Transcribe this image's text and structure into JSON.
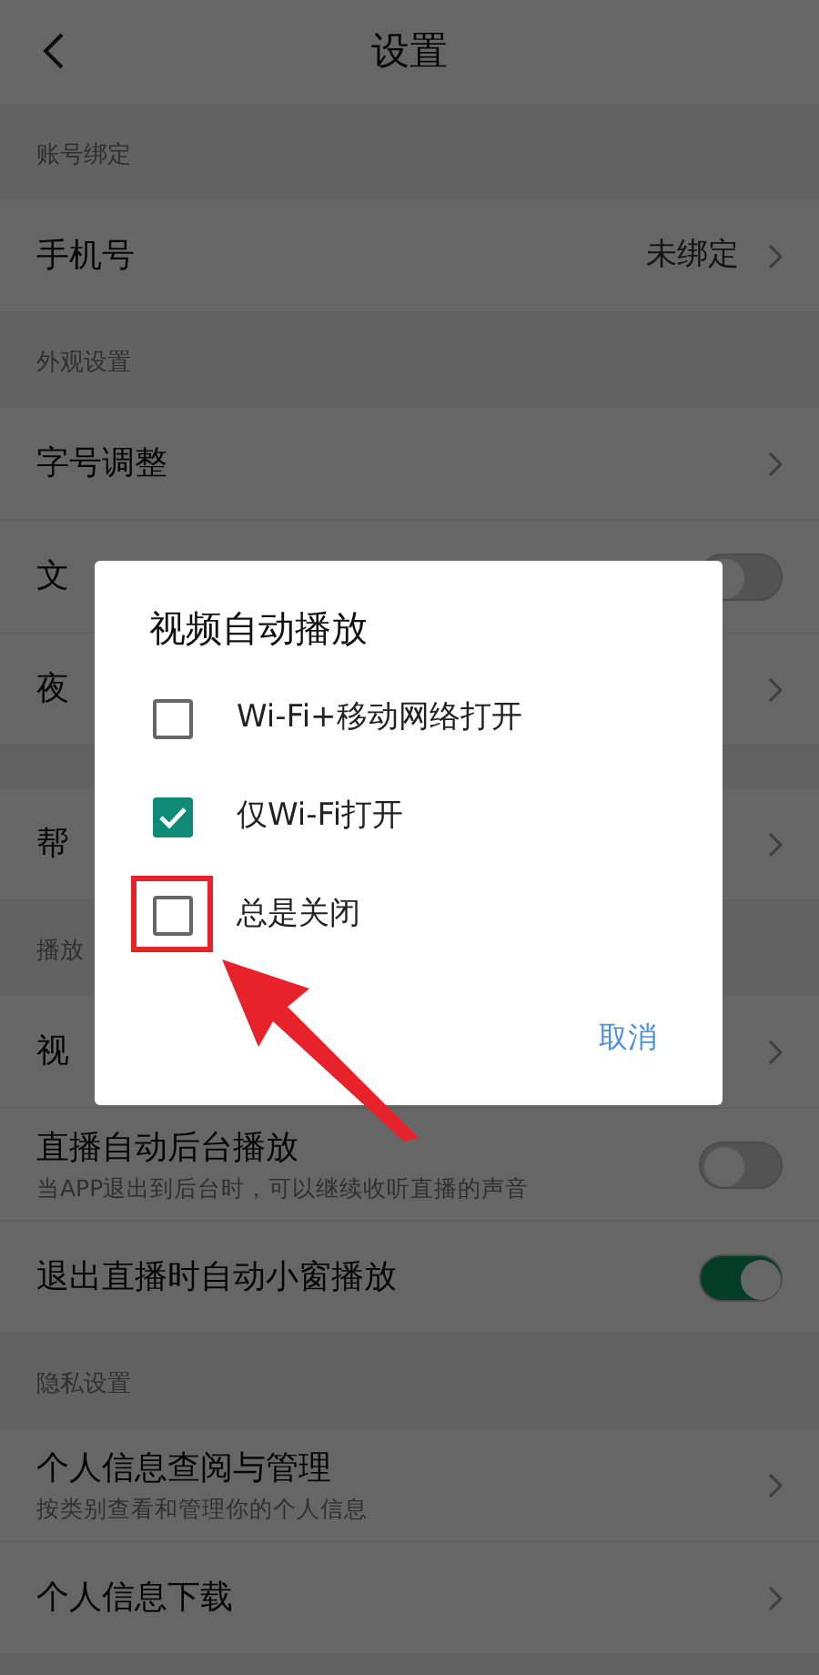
{
  "header": {
    "title": "设置"
  },
  "sections": [
    {
      "title": "账号绑定",
      "rows": [
        {
          "kind": "link",
          "label": "手机号",
          "value": "未绑定"
        }
      ]
    },
    {
      "title": "外观设置",
      "rows": [
        {
          "kind": "link",
          "label": "字号调整"
        },
        {
          "kind": "switch",
          "label": "文",
          "on": false
        },
        {
          "kind": "link",
          "label": "夜"
        }
      ]
    },
    {
      "rows": [
        {
          "kind": "link",
          "label": "帮"
        }
      ]
    },
    {
      "title": "播放",
      "rows": [
        {
          "kind": "link",
          "label": "视"
        },
        {
          "kind": "switch",
          "label": "直播自动后台播放",
          "subtitle": "当APP退出到后台时，可以继续收听直播的声音",
          "on": false
        },
        {
          "kind": "switch",
          "label": "退出直播时自动小窗播放",
          "on": true
        }
      ]
    },
    {
      "title": "隐私设置",
      "rows": [
        {
          "kind": "link",
          "label": "个人信息查阅与管理",
          "subtitle": "按类别查看和管理你的个人信息"
        },
        {
          "kind": "link",
          "label": "个人信息下载"
        }
      ]
    }
  ],
  "dialog": {
    "title": "视频自动播放",
    "options": [
      {
        "label": "Wi-Fi+移动网络打开",
        "checked": false,
        "highlighted": false
      },
      {
        "label": "仅Wi-Fi打开",
        "checked": true,
        "highlighted": false
      },
      {
        "label": "总是关闭",
        "checked": false,
        "highlighted": true
      }
    ],
    "cancel": "取消"
  }
}
